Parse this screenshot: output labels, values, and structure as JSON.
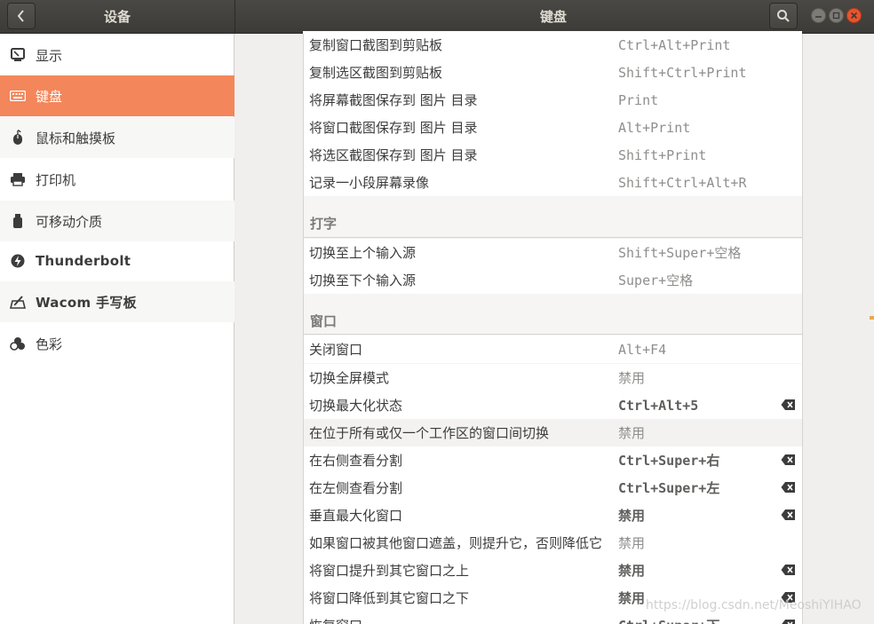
{
  "header": {
    "left_title": "设备",
    "right_title": "键盘",
    "icons": {
      "back": "chevron-left-icon",
      "search": "search-icon",
      "minimize": "minimize-icon",
      "maximize": "maximize-icon",
      "close": "close-icon"
    }
  },
  "sidebar": {
    "items": [
      {
        "label": "显示",
        "icon": "display-icon"
      },
      {
        "label": "键盘",
        "icon": "keyboard-icon",
        "active": true
      },
      {
        "label": "鼠标和触摸板",
        "icon": "mouse-icon"
      },
      {
        "label": "打印机",
        "icon": "printer-icon"
      },
      {
        "label": "可移动介质",
        "icon": "removable-media-icon"
      },
      {
        "label": "Thunderbolt",
        "icon": "thunderbolt-icon"
      },
      {
        "label": "Wacom 手写板",
        "icon": "tablet-icon"
      },
      {
        "label": "色彩",
        "icon": "color-icon"
      }
    ]
  },
  "shortcuts": {
    "screenshots": [
      {
        "label": "复制窗口截图到剪贴板",
        "accel": "Ctrl+Alt+Print"
      },
      {
        "label": "复制选区截图到剪贴板",
        "accel": "Shift+Ctrl+Print"
      },
      {
        "label": "将屏幕截图保存到 图片 目录",
        "accel": "Print"
      },
      {
        "label": "将窗口截图保存到 图片 目录",
        "accel": "Alt+Print"
      },
      {
        "label": "将选区截图保存到 图片 目录",
        "accel": "Shift+Print"
      },
      {
        "label": "记录一小段屏幕录像",
        "accel": "Shift+Ctrl+Alt+R"
      }
    ],
    "typing_title": "打字",
    "typing": [
      {
        "label": "切换至上个输入源",
        "accel": "Shift+Super+空格"
      },
      {
        "label": "切换至下个输入源",
        "accel": "Super+空格"
      }
    ],
    "windows_title": "窗口",
    "windows": [
      {
        "label": "关闭窗口",
        "accel": "Alt+F4"
      },
      {
        "label": "切换全屏模式",
        "accel": "禁用"
      },
      {
        "label": "切换最大化状态",
        "accel": "Ctrl+Alt+5",
        "modified": true
      },
      {
        "label": "在位于所有或仅一个工作区的窗口间切换",
        "accel": "禁用"
      },
      {
        "label": "在右侧查看分割",
        "accel": "Ctrl+Super+右",
        "modified": true
      },
      {
        "label": "在左侧查看分割",
        "accel": "Ctrl+Super+左",
        "modified": true
      },
      {
        "label": "垂直最大化窗口",
        "accel": "禁用",
        "modified": true
      },
      {
        "label": "如果窗口被其他窗口遮盖，则提升它，否则降低它",
        "accel": "禁用"
      },
      {
        "label": "将窗口提升到其它窗口之上",
        "accel": "禁用",
        "modified": true
      },
      {
        "label": "将窗口降低到其它窗口之下",
        "accel": "禁用",
        "modified": true
      },
      {
        "label": "恢复窗口",
        "accel": "Ctrl+Super+下",
        "modified": true
      }
    ]
  },
  "watermark": "https://blog.csdn.net/MeoshiYIHAO",
  "colors": {
    "accent": "#f3865a",
    "header_bg": "#3c3b37",
    "close_button": "#e9542e"
  }
}
